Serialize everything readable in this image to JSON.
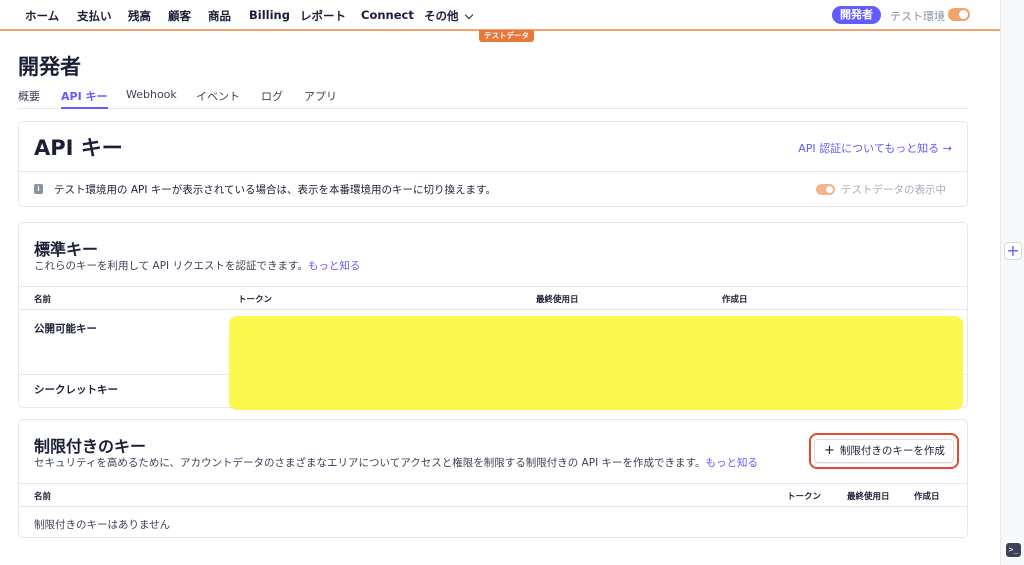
{
  "nav": {
    "items": [
      "ホーム",
      "支払い",
      "残高",
      "顧客",
      "商品",
      "Billing",
      "レポート",
      "Connect",
      "その他"
    ],
    "developer_badge": "開発者",
    "test_env_label": "テスト環境",
    "test_data_tag": "テストデータ"
  },
  "page": {
    "title": "開発者",
    "tabs": [
      "概要",
      "API キー",
      "Webhook",
      "イベント",
      "ログ",
      "アプリ"
    ],
    "active_tab": "API キー"
  },
  "api_keys_card": {
    "title": "API キー",
    "learn_link": "API 認証についてもっと知る →",
    "info_icon": "info-icon",
    "info_text": "テスト環境用の API キーが表示されている場合は、表示を本番環境用のキーに切り換えます。",
    "toggle_label": "テストデータの表示中"
  },
  "standard_keys": {
    "title": "標準キー",
    "description": "これらのキーを利用して API リクエストを認証できます。",
    "learn_more": "もっと知る",
    "columns": [
      "名前",
      "トークン",
      "最終使用日",
      "作成日"
    ],
    "rows": [
      "公開可能キー",
      "シークレットキー"
    ]
  },
  "restricted_keys": {
    "title": "制限付きのキー",
    "description": "セキュリティを高めるために、アカウントデータのさまざまなエリアについてアクセスと権限を制限する制限付きの API キーを作成できます。",
    "learn_more": "もっと知る",
    "create_button": "制限付きのキーを作成",
    "columns": [
      "名前",
      "トークン",
      "最終使用日",
      "作成日"
    ],
    "empty_message": "制限付きのキーはありません"
  },
  "side_panel": {
    "plus_icon": "plus-icon",
    "console_icon": "terminal-icon"
  },
  "colors": {
    "accent": "#635bff",
    "test_mode_orange": "#e8783a",
    "highlight_red": "#e3492f",
    "redaction_yellow": "#fbf84f"
  }
}
